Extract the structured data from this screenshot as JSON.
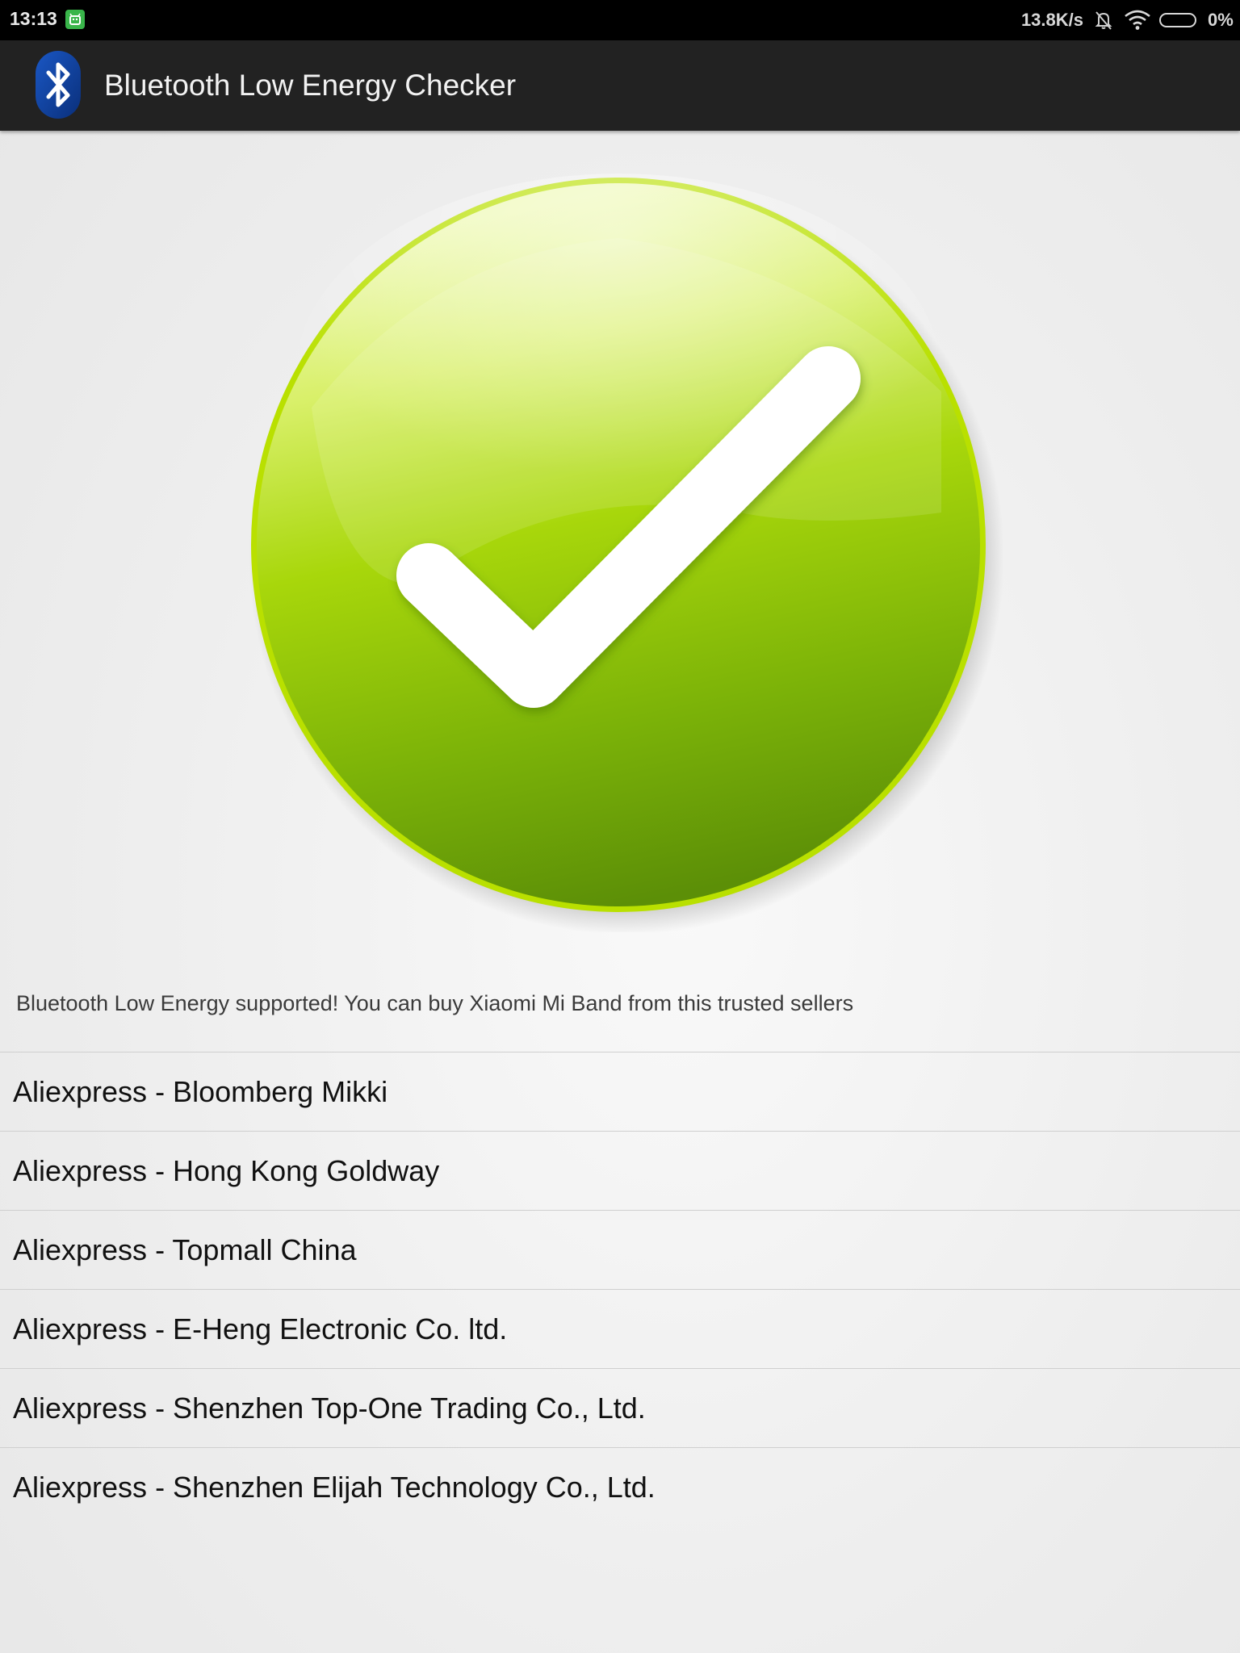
{
  "status_bar": {
    "time": "13:13",
    "notification_icon": "android-notification-icon",
    "network_speed": "13.8K/s",
    "mute_icon": "bell-off-icon",
    "wifi_icon": "wifi-icon",
    "battery_icon": "battery-icon",
    "battery_percent": "0%"
  },
  "action_bar": {
    "app_icon": "bluetooth-icon",
    "title": "Bluetooth Low Energy Checker",
    "icon_color": "#0b3f9a"
  },
  "status_graphic": {
    "icon": "checkmark-icon",
    "state": "supported",
    "color": "#8fc10a"
  },
  "message": "Bluetooth Low Energy supported! You can buy Xiaomi Mi Band from this trusted sellers",
  "sellers": [
    {
      "label": "Aliexpress - Bloomberg Mikki"
    },
    {
      "label": "Aliexpress - Hong Kong Goldway"
    },
    {
      "label": "Aliexpress - Topmall China"
    },
    {
      "label": "Aliexpress - E-Heng Electronic Co. ltd."
    },
    {
      "label": "Aliexpress - Shenzhen Top-One Trading Co., Ltd."
    },
    {
      "label": "Aliexpress - Shenzhen Elijah Technology Co., Ltd."
    }
  ]
}
